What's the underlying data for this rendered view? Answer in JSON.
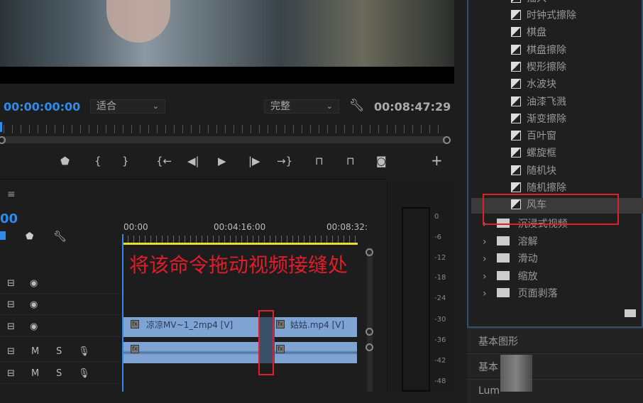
{
  "monitor": {
    "timecode_current": "00:00:00:00",
    "zoom_select": "适合",
    "quality_select": "完整",
    "timecode_duration": "00:08:47:29"
  },
  "controls": {
    "marker": "⬟",
    "in": "{",
    "out": "}",
    "goto_in": "{←",
    "step_back": "◀|",
    "play": "▶",
    "step_fwd": "|▶",
    "goto_out": "→}",
    "lift": "⊓",
    "extract": "⊓",
    "export_frame": "◙",
    "add": "+"
  },
  "timeline": {
    "menu": "≡",
    "timecode": "00",
    "ruler": [
      "00:00",
      "00:04:16:00",
      "00:08:32:"
    ],
    "clips": [
      {
        "name": "凉凉MV~1_2mp4 [V]"
      },
      {
        "name": "姑姑.mp4 [V]"
      }
    ],
    "track_labels": {
      "m": "M",
      "s": "S"
    },
    "annotation": "将该命令拖动视频接缝处"
  },
  "meter": {
    "db": [
      "0",
      "-6",
      "-12",
      "-18",
      "-24",
      "-30",
      "-36",
      "-42",
      "-48"
    ]
  },
  "effects": {
    "partial_top": "插入",
    "transitions": [
      "时钟式擦除",
      "棋盘",
      "棋盘擦除",
      "楔形擦除",
      "水波块",
      "油漆飞溅",
      "渐变擦除",
      "百叶窗",
      "螺旋框",
      "随机块",
      "随机擦除",
      "风车"
    ],
    "selected": "风车",
    "folders": [
      "沉浸式视频",
      "溶解",
      "滑动",
      "缩放",
      "页面剥落"
    ]
  },
  "sections": [
    "基本图形",
    "基本",
    "Lum"
  ],
  "colors": {
    "accent": "#2d8ceb",
    "annotation": "#e01d2a",
    "clip": "#7fa4d4"
  }
}
